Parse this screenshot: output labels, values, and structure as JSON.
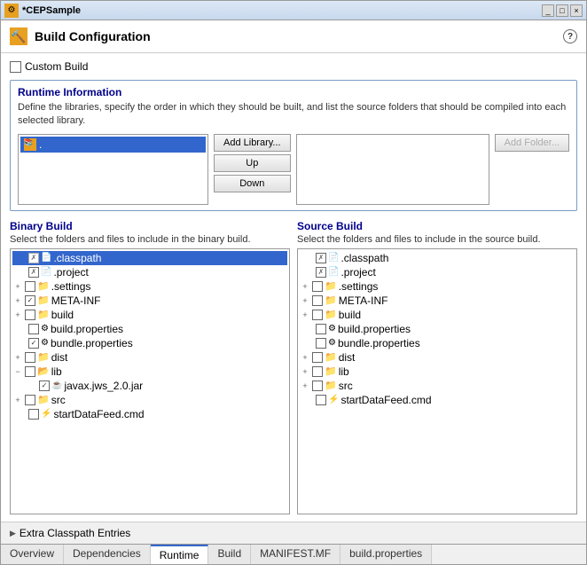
{
  "window": {
    "title": "*CEPSample",
    "close_label": "×"
  },
  "header": {
    "icon": "🔨",
    "title": "Build Configuration",
    "help": "?"
  },
  "custom_build": {
    "label": "Custom Build",
    "checked": false
  },
  "runtime_section": {
    "title": "Runtime Information",
    "description": "Define the libraries, specify the order in which they should be built, and list the source folders that should be compiled into each selected library."
  },
  "library_list": {
    "items": [
      {
        "name": ".",
        "icon": "📚"
      }
    ]
  },
  "buttons": {
    "add_library": "Add Library...",
    "up": "Up",
    "down": "Down",
    "add_folder": "Add Folder..."
  },
  "binary_build": {
    "title": "Binary Build",
    "description": "Select the folders and files to include in the binary build.",
    "tree": [
      {
        "level": 0,
        "expand": false,
        "check": "x",
        "type": "file",
        "name": ".classpath",
        "selected": true
      },
      {
        "level": 0,
        "expand": false,
        "check": "x",
        "type": "file",
        "name": ".project",
        "selected": false
      },
      {
        "level": 0,
        "expand": true,
        "check": "none",
        "type": "folder",
        "name": ".settings",
        "selected": false
      },
      {
        "level": 0,
        "expand": true,
        "check": "checked",
        "type": "folder",
        "name": "META-INF",
        "selected": false
      },
      {
        "level": 0,
        "expand": true,
        "check": "none",
        "type": "folder",
        "name": "build",
        "selected": false
      },
      {
        "level": 0,
        "expand": false,
        "check": "none",
        "type": "file",
        "name": "build.properties",
        "selected": false
      },
      {
        "level": 0,
        "expand": false,
        "check": "checked",
        "type": "file",
        "name": "bundle.properties",
        "selected": false
      },
      {
        "level": 0,
        "expand": true,
        "check": "none",
        "type": "folder",
        "name": "dist",
        "selected": false
      },
      {
        "level": 0,
        "expand": true,
        "check": "none",
        "type": "folder-open",
        "name": "lib",
        "selected": false
      },
      {
        "level": 1,
        "expand": false,
        "check": "checked",
        "type": "jar",
        "name": "javax.jws_2.0.jar",
        "selected": false
      },
      {
        "level": 0,
        "expand": true,
        "check": "none",
        "type": "folder",
        "name": "src",
        "selected": false
      },
      {
        "level": 0,
        "expand": false,
        "check": "none",
        "type": "cmd",
        "name": "startDataFeed.cmd",
        "selected": false
      }
    ]
  },
  "source_build": {
    "title": "Source Build",
    "description": "Select the folders and files to include in the source build.",
    "tree": [
      {
        "level": 0,
        "expand": false,
        "check": "x",
        "type": "file",
        "name": ".classpath",
        "selected": false
      },
      {
        "level": 0,
        "expand": false,
        "check": "x",
        "type": "file",
        "name": ".project",
        "selected": false
      },
      {
        "level": 0,
        "expand": true,
        "check": "none",
        "type": "folder",
        "name": ".settings",
        "selected": false
      },
      {
        "level": 0,
        "expand": true,
        "check": "none",
        "type": "folder",
        "name": "META-INF",
        "selected": false
      },
      {
        "level": 0,
        "expand": true,
        "check": "none",
        "type": "folder",
        "name": "build",
        "selected": false
      },
      {
        "level": 0,
        "expand": false,
        "check": "none",
        "type": "file",
        "name": "build.properties",
        "selected": false
      },
      {
        "level": 0,
        "expand": false,
        "check": "none",
        "type": "file",
        "name": "bundle.properties",
        "selected": false
      },
      {
        "level": 0,
        "expand": true,
        "check": "none",
        "type": "folder",
        "name": "dist",
        "selected": false
      },
      {
        "level": 0,
        "expand": true,
        "check": "none",
        "type": "folder",
        "name": "lib",
        "selected": false
      },
      {
        "level": 0,
        "expand": true,
        "check": "none",
        "type": "folder",
        "name": "src",
        "selected": false
      },
      {
        "level": 0,
        "expand": false,
        "check": "none",
        "type": "cmd",
        "name": "startDataFeed.cmd",
        "selected": false
      }
    ]
  },
  "extra_classpath": {
    "label": "Extra Classpath Entries"
  },
  "tabs": [
    {
      "label": "Overview",
      "active": false
    },
    {
      "label": "Dependencies",
      "active": false
    },
    {
      "label": "Runtime",
      "active": true
    },
    {
      "label": "Build",
      "active": false
    },
    {
      "label": "MANIFEST.MF",
      "active": false
    },
    {
      "label": "build.properties",
      "active": false
    }
  ]
}
